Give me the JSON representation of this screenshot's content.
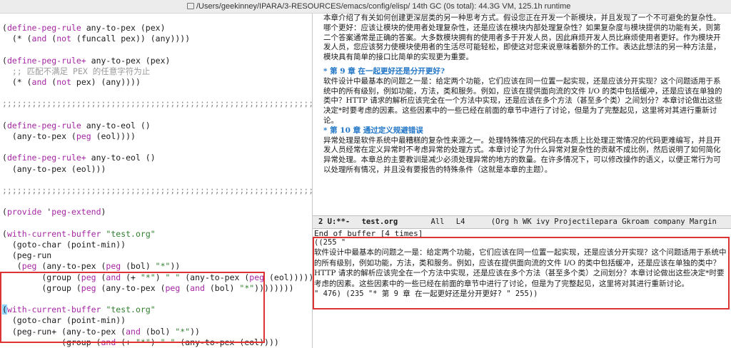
{
  "title_bar": {
    "text": "/Users/geekinney/IPARA/3-RESOURCES/emacs/config/elisp/  14th GC (0s total): 44.3G VM, 125.1h runtime"
  },
  "code_pane": {
    "semis": ";;;;;;;;;;;;;;;;;;;;;;;;;;;;;;;;;;;;;;;;;;;;;;;;;;;;;;;;;;;;;;;;;;;;;;",
    "comment": ";; 匹配不满足 PEX 的任意字符为止"
  },
  "doc_pane": {
    "intro": "本章介绍了有关如何创建更深层类的另一种思考方式。假设您正在开发一个新模块，并且发现了一个不可避免的复杂性。哪个更好：应该让模块的使用者处理复杂性，还是应该在模块内部处理复杂性？如果复杂度与模块提供的功能有关，则第二个答案通常是正确的答案。大多数模块拥有的使用者多于开发人员，因此麻烦开发人员比麻烦使用者更好。作为模块开发人员，您应该努力使模块使用者的生活尽可能轻松，即使这对您来说意味着额外的工作。表达此想法的另一种方法是，模块具有简单的接口比简单的实现更为重要。",
    "h9": "* 第 9 章 在一起更好还是分开更好?",
    "p9": "软件设计中最基本的问题之一是：给定两个功能，它们应该在同一位置一起实现，还是应该分开实现？这个问题适用于系统中的所有级别，例如功能，方法，类和服务。例如，应该在提供面向流的文件 I/O 的类中包括缓冲，还是应该在单独的类中？HTTP 请求的解析应该完全在一个方法中实现，还是应该在多个方法（甚至多个类）之间划分？本章讨论做出这些决定*时要考虑的因素。这些因素中的一些已经在前面的章节中进行了讨论，但是为了完整起见，这里将对其进行重新讨论。",
    "h10": "* 第 10 章 通过定义规避错误",
    "p10": "异常处理是软件系统中最糟糕的复杂性来源之一。处理特殊情况的代码在本质上比处理正常情况的代码更难编写，并且开发人员经常在定义异常时不考虑异常的处理方式。本章讨论了为什么异常对复杂性的贡献不成比例，然后说明了如何简化异常处理。本章总的主要教训是减少必须处理异常的地方的数量。在许多情况下，可以修改操作的语义，以便正常行为可以处理所有情况，并且没有要报告的特殊条件（这就是本章的主题）。"
  },
  "modeline": {
    "status": "2  U:**-",
    "buffer": "test.org",
    "position": "All",
    "line": "L4",
    "modes": "(Org h WK ivy Projectilepara Gkroam company Margin"
  },
  "echo_area": {
    "message": "End of buffer [4 times]"
  },
  "result": {
    "open": "((255 \"",
    "text": "软件设计中最基本的问题之一是：给定两个功能，它们应该在同一位置一起实现，还是应该分开实现？这个问题适用于系统中的所有级别，例如功能，方法，类和服务。例如，应该在提供面向流的文件 I/O 的类中包括缓冲，还是应该在单独的类中？HTTP 请求的解析应该完全在一个方法中实现，还是应该在多个方法（甚至多个类）之间划分？本章讨论做出这些决定*时要考虑的因素。这些因素中的一些已经在前面的章节中进行了讨论，但是为了完整起见，这里将对其进行重新讨论。",
    "close": "\" 476) (235 \"* 第 9 章 在一起更好还是分开更好? \" 255))"
  }
}
